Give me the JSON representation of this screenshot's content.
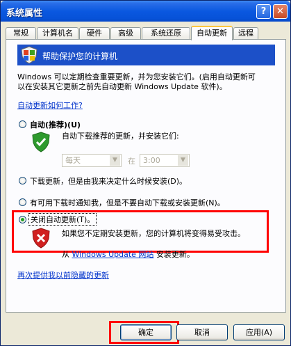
{
  "window": {
    "title": "系统属性",
    "help_glyph": "?",
    "close_glyph": "✕"
  },
  "tabs": [
    "常规",
    "计算机名",
    "硬件",
    "高级",
    "系统还原",
    "自动更新",
    "远程"
  ],
  "active_tab": "自动更新",
  "header": {
    "text": "帮助保护您的计算机"
  },
  "description": {
    "line1": "Windows 可以定期检查重要更新，并为您安装它们。(启用自动更新可",
    "line2": "以在安装其它更新之前先自动更新 Windows Update 软件)。"
  },
  "how_link": "自动更新如何工作?",
  "options": {
    "auto": {
      "label": "自动(推荐)(U)",
      "desc": "自动下载推荐的更新，并安装它们:"
    },
    "schedule": {
      "day": "每天",
      "at": "在",
      "time": "3:00"
    },
    "download": {
      "label": "下载更新，但是由我来决定什么时候安装(D)。"
    },
    "notify": {
      "label": "有可用下载时通知我，但是不要自动下载或安装更新(N)。"
    },
    "off": {
      "label": "关闭自动更新(T)。",
      "warning": "如果您不定期安装更新，您的计算机将变得易受攻击。",
      "from_prefix": "从",
      "from_link": "Windows Update 网站",
      "from_suffix": "安装更新。"
    }
  },
  "hidden_updates_link": "再次提供我以前隐藏的更新",
  "buttons": {
    "ok": "确定",
    "cancel": "取消",
    "apply": "应用(A)"
  },
  "colors": {
    "highlight": "#ff0000",
    "header_bar": "#1c50c8",
    "link": "#0033cc"
  }
}
